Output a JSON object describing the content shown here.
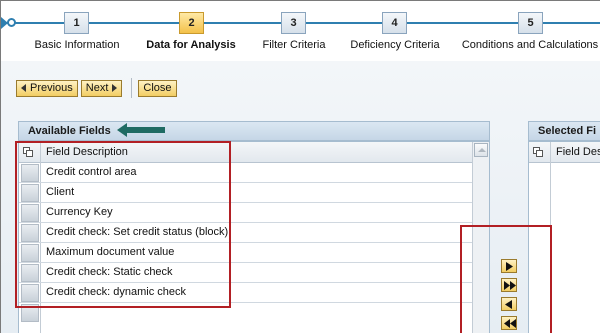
{
  "roadmap": {
    "steps": [
      {
        "number": "1",
        "label": "Basic Information"
      },
      {
        "number": "2",
        "label": "Data for Analysis"
      },
      {
        "number": "3",
        "label": "Filter Criteria"
      },
      {
        "number": "4",
        "label": "Deficiency Criteria"
      },
      {
        "number": "5",
        "label": "Conditions and Calculations"
      }
    ],
    "active_step": "2"
  },
  "toolbar": {
    "previous_label": "Previous",
    "next_label": "Next",
    "close_label": "Close"
  },
  "available_fields": {
    "title": "Available Fields",
    "column_header": "Field Description",
    "rows": [
      "Credit control area",
      "Client",
      "Currency Key",
      "Credit check: Set credit status (block)",
      "Maximum document value",
      "Credit check: Static check",
      "Credit check: dynamic check"
    ]
  },
  "selected_fields": {
    "title": "Selected Fi",
    "column_header": "Field Desc"
  },
  "move_buttons": [
    "move-right",
    "move-all-right",
    "move-left",
    "move-all-left"
  ],
  "colors": {
    "accent_blue": "#2f7fb0",
    "button_gold": "#f2cd63",
    "highlight_red": "#b21f24",
    "callout_teal": "#1f6b63"
  }
}
